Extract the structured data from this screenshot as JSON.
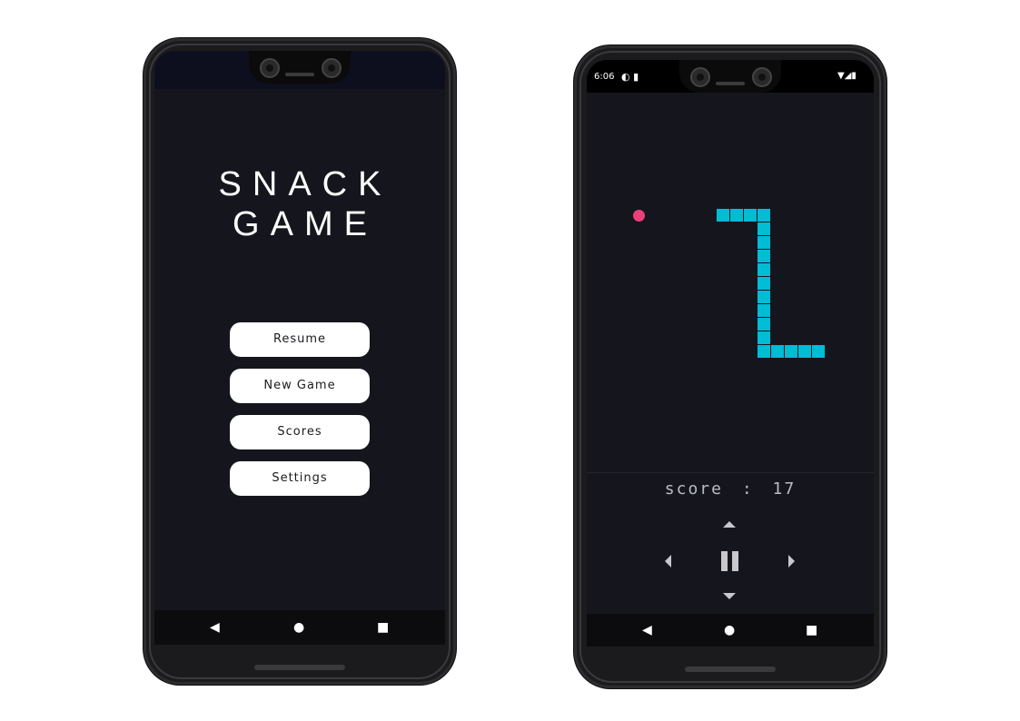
{
  "menu_screen": {
    "title_line1": "SNACK",
    "title_line2": "GAME",
    "buttons": {
      "resume": "Resume",
      "new_game": "New Game",
      "scores": "Scores",
      "settings": "Settings"
    }
  },
  "game_screen": {
    "status_bar": {
      "time": "6:06"
    },
    "score_label": "score",
    "score_separator": ":",
    "score_value": "17",
    "colors": {
      "snake": "#00bcd4",
      "food": "#ec407a",
      "background": "#15161d"
    },
    "controls": [
      "up-arrow-icon",
      "left-arrow-icon",
      "pause-icon",
      "right-arrow-icon",
      "down-arrow-icon"
    ]
  },
  "system_nav": {
    "back_icon": "◀",
    "home_icon": "●",
    "recents_icon": "■"
  }
}
